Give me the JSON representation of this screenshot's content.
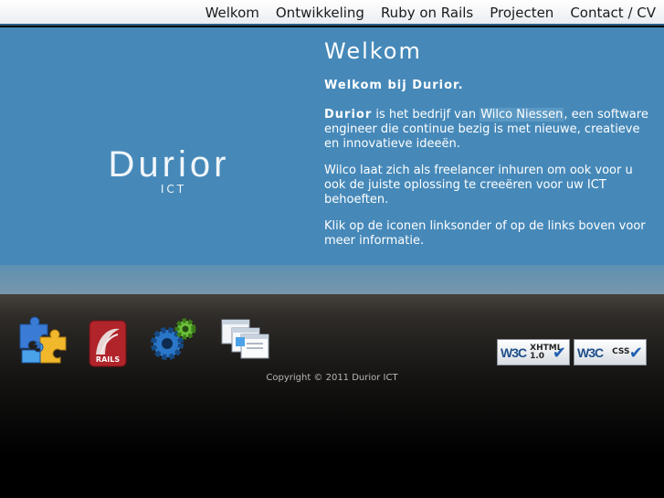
{
  "nav": {
    "items": [
      "Welkom",
      "Ontwikkeling",
      "Ruby on Rails",
      "Projecten",
      "Contact / CV"
    ]
  },
  "logo": {
    "name": "Durior",
    "sub": "ICT"
  },
  "content": {
    "title": "Welkom",
    "intro": "Welkom bij Durior.",
    "p1_brand": "Durior",
    "p1_pre": " is het bedrijf van ",
    "p1_person": "Wilco Niessen",
    "p1_post": ", een software engineer die continue bezig is met nieuwe, creatieve en innovatieve ideeën.",
    "p2": "Wilco laat zich als freelancer inhuren om ook voor u ook de juiste oplossing te creeëren voor uw ICT behoeften.",
    "p3": "Klik op de iconen linksonder of op de links boven voor meer informatie."
  },
  "footer": {
    "icons": [
      "puzzle-icon",
      "rails-icon",
      "gears-icon",
      "windows-icon"
    ],
    "rails_label": "RAILS",
    "badge_xhtml": {
      "w3c": "W3C",
      "line1": "XHTML",
      "line2": "1.0"
    },
    "badge_css": {
      "w3c": "W3C",
      "line1": "CSS"
    },
    "copyright": "Copyright © 2011 Durior ICT"
  },
  "colors": {
    "main_blue": "#4689b9",
    "nav_border": "#2e5f86"
  }
}
